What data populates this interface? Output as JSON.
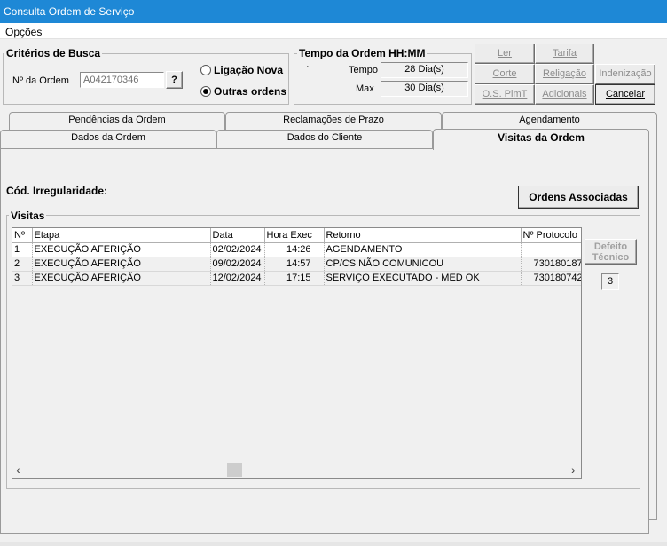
{
  "window": {
    "title": "Consulta Ordem de Serviço"
  },
  "menu": {
    "options_label": "Opções"
  },
  "search": {
    "group_title": "Critérios de Busca",
    "order_label": "Nº da Ordem",
    "order_value": "A042170346",
    "lookup_label": "?",
    "radio_new": "Ligação Nova",
    "radio_other": "Outras ordens",
    "radio_other_selected": true
  },
  "time": {
    "group_title": "Tempo da Ordem HH:MM",
    "dot": "·",
    "tempo_label": "Tempo",
    "tempo_value": "28 Dia(s)",
    "max_label": "Max",
    "max_value": "30 Dia(s)"
  },
  "buttons": {
    "ler": "Ler",
    "tarifa": "Tarifa",
    "corte": "Corte",
    "religacao": "Religação",
    "indenizacao": "Indenização",
    "os_pimt": "O.S. PimT",
    "adicionais": "Adicionais",
    "cancelar": "Cancelar"
  },
  "tabs": {
    "pendencias": "Pendências da Ordem",
    "reclamacoes": "Reclamações de Prazo",
    "agendamento": "Agendamento",
    "dados_ordem": "Dados da Ordem",
    "dados_cliente": "Dados do Cliente",
    "visitas_ordem": "Visitas da Ordem"
  },
  "panel": {
    "irregularidade_label": "Cód. Irregularidade:",
    "ordens_associadas": "Ordens Associadas",
    "visitas_title": "Visitas",
    "defeito_line1": "Defeito",
    "defeito_line2": "Técnico",
    "count": "3"
  },
  "table": {
    "headers": [
      "Nº",
      "Etapa",
      "Data",
      "Hora Exec",
      "Retorno",
      "Nº Protocolo"
    ],
    "rows": [
      [
        "1",
        "EXECUÇÃO AFERIÇÃO",
        "02/02/2024",
        "14:26",
        "AGENDAMENTO",
        ""
      ],
      [
        "2",
        "EXECUÇÃO AFERIÇÃO",
        "09/02/2024",
        "14:57",
        "CP/CS NÃO COMUNICOU",
        "730180187"
      ],
      [
        "3",
        "EXECUÇÃO AFERIÇÃO",
        "12/02/2024",
        "17:15",
        "SERVIÇO EXECUTADO - MED OK",
        "730180742"
      ]
    ],
    "scroll_left": "‹",
    "scroll_right": "›"
  }
}
